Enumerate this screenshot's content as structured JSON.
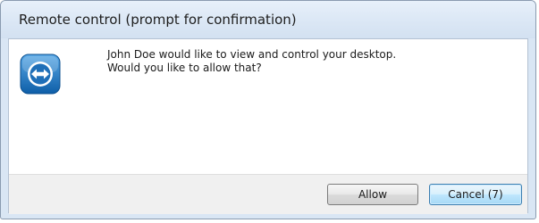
{
  "window": {
    "title": "Remote control (prompt for confirmation)"
  },
  "dialog": {
    "icon": "teamviewer-logo-icon",
    "message_line1": "John Doe would like to view and control your desktop.",
    "message_line2": "Would you like to allow that?"
  },
  "buttons": {
    "allow_label": "Allow",
    "cancel_label": "Cancel (7)"
  },
  "colors": {
    "accent": "#1f6fb8",
    "titlebar": "#dbe7f5"
  }
}
